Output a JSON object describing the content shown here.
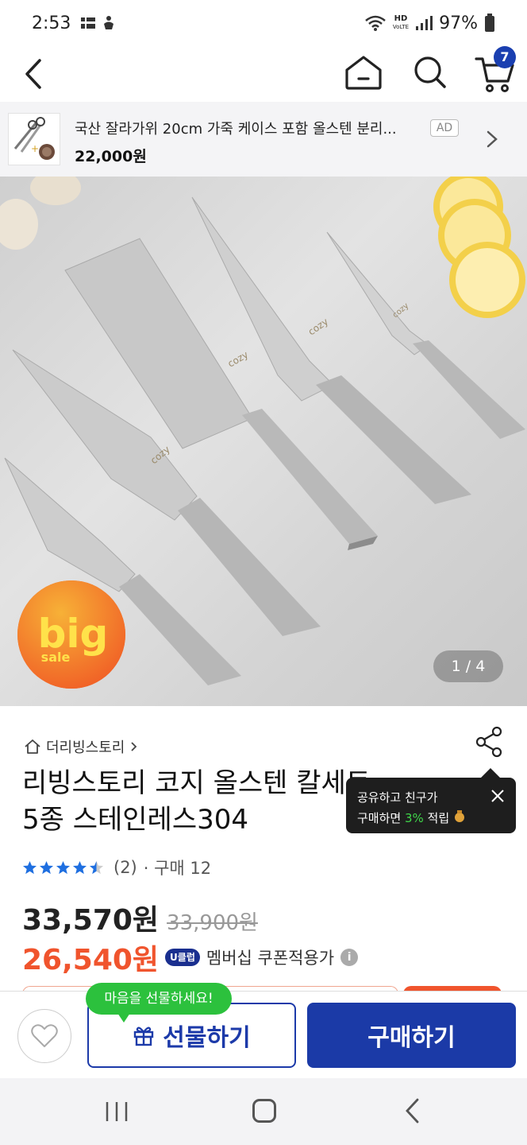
{
  "status_bar": {
    "time": "2:53",
    "hd_top": "HD",
    "hd_bottom": "VoLTE",
    "battery": "97%"
  },
  "nav": {
    "cart_count": "7"
  },
  "ad_banner": {
    "title": "국산 잘라가위 20cm 가죽 케이스 포함 올스텐 분리...",
    "price": "22,000원",
    "badge": "AD"
  },
  "hero": {
    "brand_mark": "cozy",
    "sale_badge_top": "big",
    "sale_badge_bottom": "sale",
    "counter": "1 / 4"
  },
  "product": {
    "store": "더리빙스토리",
    "title_line1": "리빙스토리 코지 올스텐 칼세트",
    "title_line2": "5종 스테인레스304",
    "rating_stars": 4.5,
    "review_count": "(2)",
    "purchase_count": "· 구매 12",
    "price": "33,570원",
    "original_price": "33,900원",
    "coupon_price": "26,540원",
    "uclub_badge": "U클럽",
    "member_text": "멤버십 쿠폰적용가",
    "info_icon": "i"
  },
  "tooltip": {
    "line1": "공유하고 친구가",
    "line2_prefix": "구매하면 ",
    "line2_highlight": "3%",
    "line2_suffix": " 적립"
  },
  "actions": {
    "gift_bubble": "마음을 선물하세요!",
    "gift_label": "선물하기",
    "buy_label": "구매하기"
  },
  "colors": {
    "primary": "#1b3aa7",
    "sale": "#f0542d",
    "green": "#2cc13d",
    "star": "#1f6fe0"
  }
}
